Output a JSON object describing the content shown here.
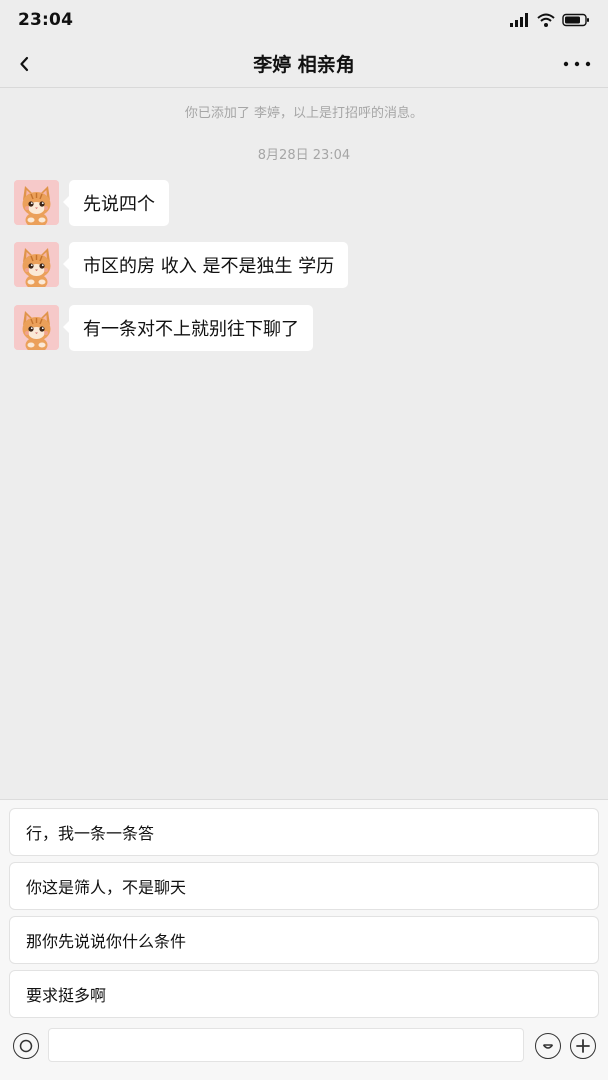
{
  "status_bar": {
    "time": "23:04"
  },
  "nav": {
    "back_glyph": "‹",
    "title": "李婷 相亲角",
    "more_glyph": "···"
  },
  "chat": {
    "system_note": "你已添加了 李婷，以上是打招呼的消息。",
    "timestamp": "8月28日 23:04",
    "messages": [
      {
        "sender": "李婷",
        "text": "先说四个"
      },
      {
        "sender": "李婷",
        "text": "市区的房 收入 是不是独生 学历"
      },
      {
        "sender": "李婷",
        "text": "有一条对不上就别往下聊了"
      }
    ]
  },
  "suggestions": [
    "行，我一条一条答",
    "你这是筛人，不是聊天",
    "那你先说说你什么条件",
    "要求挺多啊"
  ],
  "input_bar": {
    "voice_icon": "voice-icon",
    "emoji_icon": "emoji-icon",
    "plus_icon": "plus-icon",
    "value": ""
  },
  "colors": {
    "background": "#ededed",
    "bubble": "#ffffff",
    "avatar_bg": "#f6c9c9"
  }
}
